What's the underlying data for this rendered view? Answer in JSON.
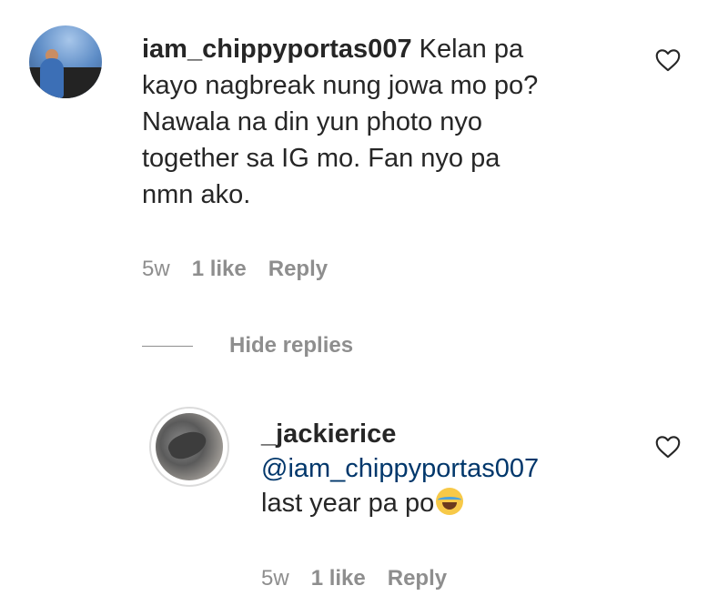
{
  "comment": {
    "username": "iam_chippyportas007",
    "text_lines": [
      "Kelan pa",
      "kayo nagbreak nung jowa mo po?",
      "Nawala na din yun photo nyo",
      "together sa IG mo. Fan nyo pa",
      "nmn ako."
    ],
    "time": "5w",
    "likes": "1 like",
    "reply_label": "Reply"
  },
  "hide_replies_label": "Hide replies",
  "reply": {
    "username": "_jackierice",
    "mention": "@iam_chippyportas007",
    "text": "last year pa po",
    "emoji": "face-with-tears-of-joy",
    "time": "5w",
    "likes": "1 like",
    "reply_label": "Reply"
  },
  "icons": {
    "like": "heart-outline-icon"
  },
  "colors": {
    "text": "#262626",
    "secondary": "#8e8e8e",
    "mention": "#00376b"
  }
}
